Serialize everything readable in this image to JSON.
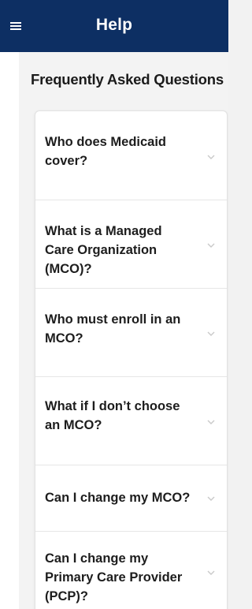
{
  "header": {
    "title": "Help",
    "menu_icon": "hamburger-menu-icon"
  },
  "faq": {
    "section_title": "Frequently Asked Questions",
    "items": [
      {
        "question": "Who does Medicaid cover?"
      },
      {
        "question": "What is a Managed Care Organization (MCO)?"
      },
      {
        "question": "Who must enroll in an MCO?"
      },
      {
        "question": "What if I don’t choose an MCO?"
      },
      {
        "question": "Can I change my MCO?"
      },
      {
        "question": "Can I change my Primary Care Provider (PCP)?"
      }
    ],
    "expand_icon": "chevron-down-icon"
  },
  "colors": {
    "header_bg": "#0d2f63",
    "header_text": "#ffffff",
    "page_bg": "#f3f3f3",
    "card_bg": "#ffffff",
    "chevron": "#c9c9c9"
  }
}
